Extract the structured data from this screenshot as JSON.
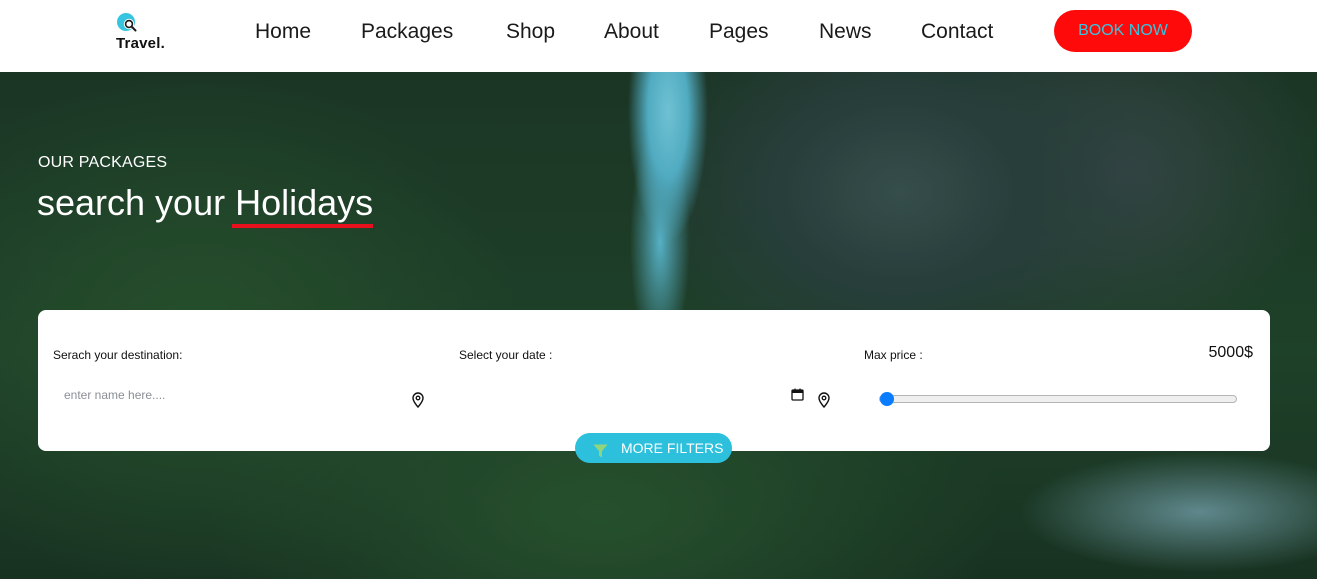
{
  "brand": {
    "name": "Travel.",
    "icon": "search-globe-icon",
    "color": "#36c5e0"
  },
  "nav": {
    "items": [
      {
        "label": "Home"
      },
      {
        "label": "Packages"
      },
      {
        "label": "Shop"
      },
      {
        "label": "About"
      },
      {
        "label": "Pages"
      },
      {
        "label": "News"
      },
      {
        "label": "Contact"
      }
    ],
    "cta": {
      "label": "BOOK NOW",
      "bg_color": "#ff0a0a",
      "text_color": "#36c5e0"
    }
  },
  "hero": {
    "subtitle": "OUR PACKAGES",
    "title_prefix": "search your",
    "title_highlight": "Holidays",
    "underline_color": "#e8101c"
  },
  "search": {
    "destination": {
      "label": "Serach your destination:",
      "placeholder": "enter name here....",
      "value": "",
      "icon": "map-pin-icon"
    },
    "date": {
      "label": "Select your date :",
      "value": "",
      "icons": [
        "calendar-icon",
        "map-pin-icon"
      ]
    },
    "price": {
      "label": "Max price :",
      "value_text": "5000$",
      "slider_fraction": 0.0,
      "thumb_color": "#0a7cff"
    },
    "more_filters": {
      "label": "MORE FILTERS",
      "icon": "filter-icon",
      "color": "#2cc0dc"
    }
  }
}
